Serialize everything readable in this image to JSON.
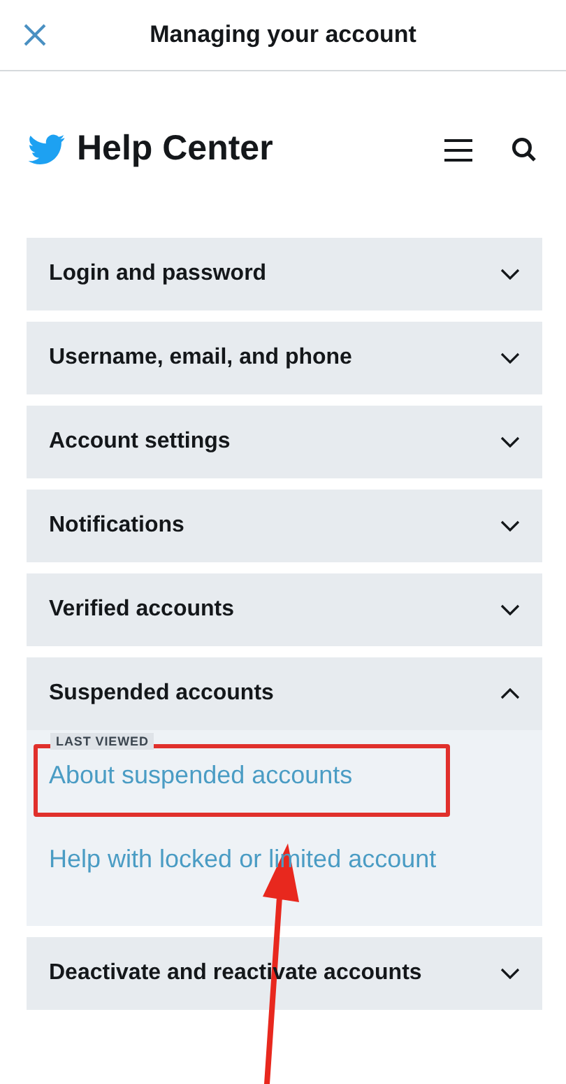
{
  "top_bar": {
    "title": "Managing your account"
  },
  "header": {
    "brand": "Help Center"
  },
  "sections": [
    {
      "title": "Login and password",
      "expanded": false
    },
    {
      "title": "Username, email, and phone",
      "expanded": false
    },
    {
      "title": "Account settings",
      "expanded": false
    },
    {
      "title": "Notifications",
      "expanded": false
    },
    {
      "title": "Verified accounts",
      "expanded": false
    },
    {
      "title": "Suspended accounts",
      "expanded": true,
      "links": [
        {
          "badge": "LAST VIEWED",
          "label": "About suspended accounts",
          "highlighted": true
        },
        {
          "label": "Help with locked or limited account",
          "highlighted": false
        }
      ]
    },
    {
      "title": "Deactivate and reactivate accounts",
      "expanded": false
    }
  ]
}
